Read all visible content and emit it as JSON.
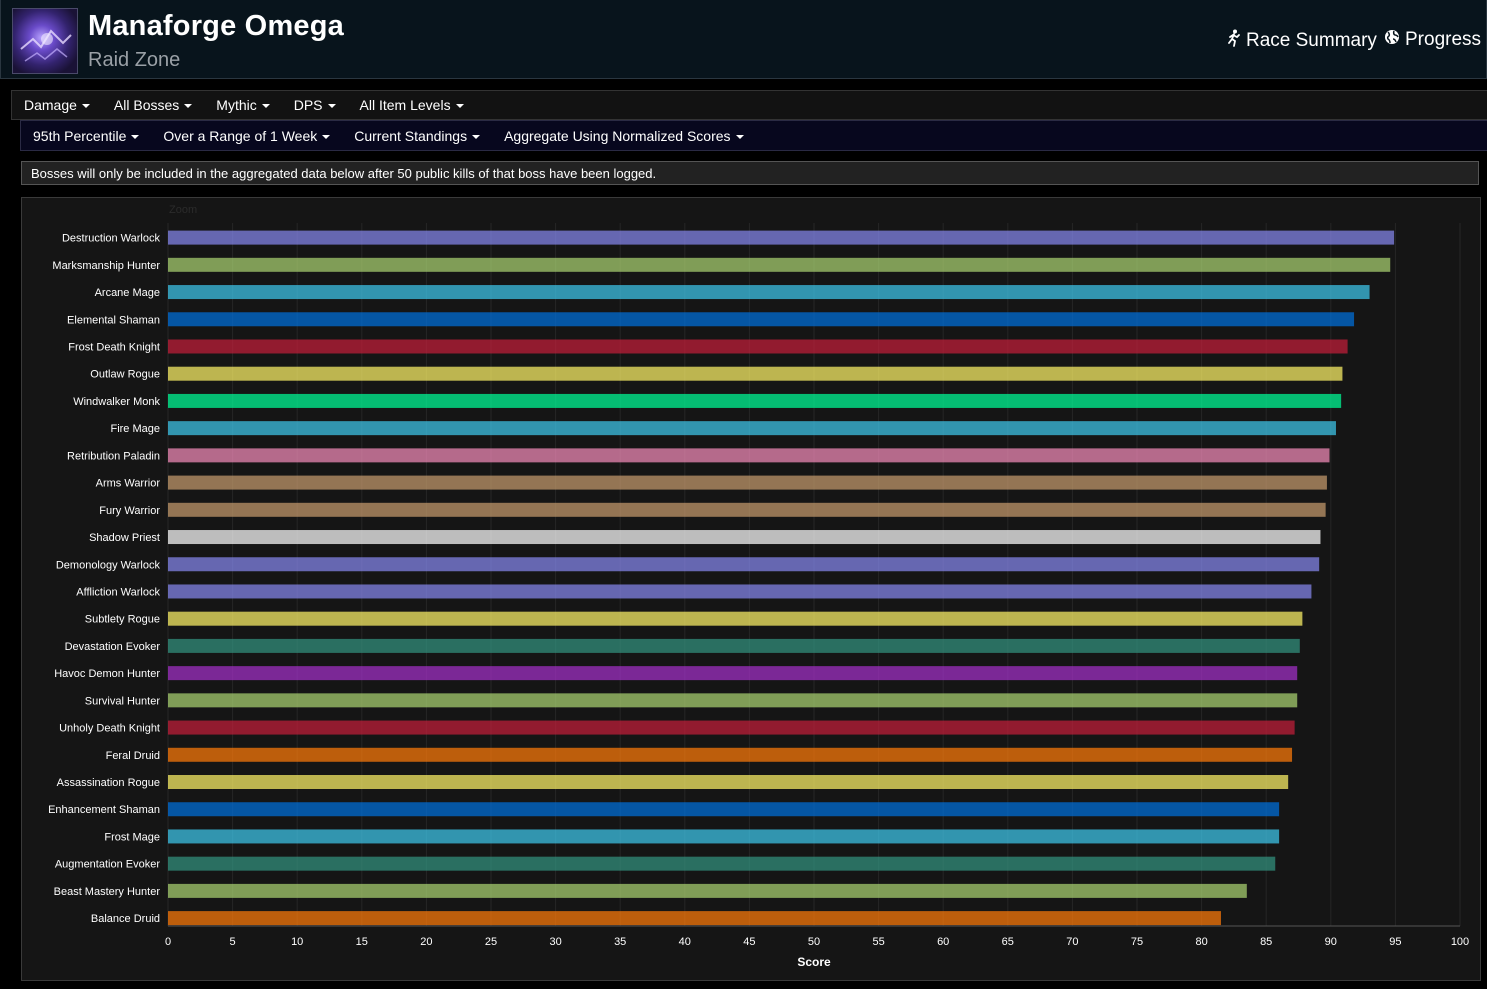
{
  "header": {
    "title": "Manaforge Omega",
    "subtitle": "Raid Zone",
    "race_summary_label": "Race Summary",
    "progress_label": "Progress",
    "race_icon": "running-figure-icon",
    "progress_icon": "globe-icon"
  },
  "filters_primary": [
    "Damage",
    "All Bosses",
    "Mythic",
    "DPS",
    "All Item Levels"
  ],
  "filters_secondary": [
    "95th Percentile",
    "Over a Range of 1 Week",
    "Current Standings",
    "Aggregate Using Normalized Scores"
  ],
  "notice": "Bosses will only be included in the aggregated data below after 50 public kills of that boss have been logged.",
  "chart_data": {
    "type": "bar",
    "orientation": "horizontal",
    "zoom_label": "Zoom",
    "xlabel": "Score",
    "xlim": [
      0,
      100
    ],
    "xticks": [
      0,
      5,
      10,
      15,
      20,
      25,
      30,
      35,
      40,
      45,
      50,
      55,
      60,
      65,
      70,
      75,
      80,
      85,
      90,
      95,
      100
    ],
    "grid": true,
    "categories": [
      "Destruction Warlock",
      "Marksmanship Hunter",
      "Arcane Mage",
      "Elemental Shaman",
      "Frost Death Knight",
      "Outlaw Rogue",
      "Windwalker Monk",
      "Fire Mage",
      "Retribution Paladin",
      "Arms Warrior",
      "Fury Warrior",
      "Shadow Priest",
      "Demonology Warlock",
      "Affliction Warlock",
      "Subtlety Rogue",
      "Devastation Evoker",
      "Havoc Demon Hunter",
      "Survival Hunter",
      "Unholy Death Knight",
      "Feral Druid",
      "Assassination Rogue",
      "Enhancement Shaman",
      "Frost Mage",
      "Augmentation Evoker",
      "Beast Mastery Hunter",
      "Balance Druid"
    ],
    "values": [
      94.9,
      94.6,
      93.0,
      91.8,
      91.3,
      90.9,
      90.8,
      90.4,
      89.9,
      89.7,
      89.6,
      89.2,
      89.1,
      88.5,
      87.8,
      87.6,
      87.4,
      87.4,
      87.2,
      87.0,
      86.7,
      86.0,
      86.0,
      85.7,
      83.5,
      81.5
    ],
    "colors": [
      "#8788ee",
      "#aad372",
      "#3fc7eb",
      "#0070dd",
      "#c41e3a",
      "#fff468",
      "#00ff98",
      "#3fc7eb",
      "#f48cba",
      "#c69b6d",
      "#c69b6d",
      "#ffffff",
      "#8788ee",
      "#8788ee",
      "#fff468",
      "#33937f",
      "#a330c9",
      "#aad372",
      "#c41e3a",
      "#ff7c0a",
      "#fff468",
      "#0070dd",
      "#3fc7eb",
      "#33937f",
      "#aad372",
      "#ff7c0a"
    ]
  }
}
